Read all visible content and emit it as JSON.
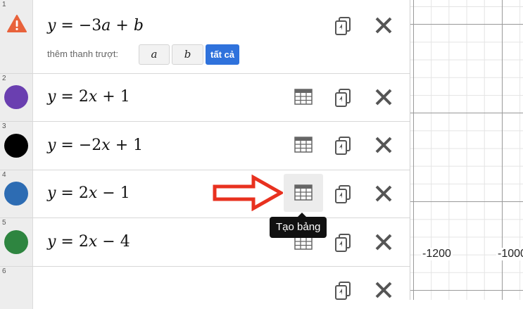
{
  "graph": {
    "x_tick_labels": [
      "-1200",
      "-1000"
    ],
    "gridline_color": "#e4e4e4"
  },
  "expressions": [
    {
      "number": "1",
      "status": "warning",
      "status_icon": "warning-icon",
      "formula_parts": [
        "y",
        " = −3",
        "a",
        " + ",
        "b"
      ],
      "slider_hint": "thêm thanh trượt:",
      "slider_buttons": [
        "a",
        "b",
        "tất cả"
      ]
    },
    {
      "number": "2",
      "color": "#6a3fb0",
      "formula_parts": [
        "y",
        " = 2",
        "x",
        " + 1"
      ]
    },
    {
      "number": "3",
      "color": "#000000",
      "formula_parts": [
        "y",
        " = −2",
        "x",
        " + 1"
      ]
    },
    {
      "number": "4",
      "color": "#2d6cb3",
      "formula_parts": [
        "y",
        " = 2",
        "x",
        " − 1"
      ]
    },
    {
      "number": "5",
      "color": "#2e8540",
      "formula_parts": [
        "y",
        " = 2",
        "x",
        " − 4"
      ]
    },
    {
      "number": "6"
    }
  ],
  "tooltip": {
    "text": "Tạo bảng"
  },
  "colors": {
    "warning": "#e8623b",
    "annotation_arrow": "#e8311f",
    "slider_all_button": "#2f72dc",
    "icon": "#555555"
  },
  "icons": [
    "table-icon",
    "duplicate-icon",
    "delete-icon"
  ]
}
